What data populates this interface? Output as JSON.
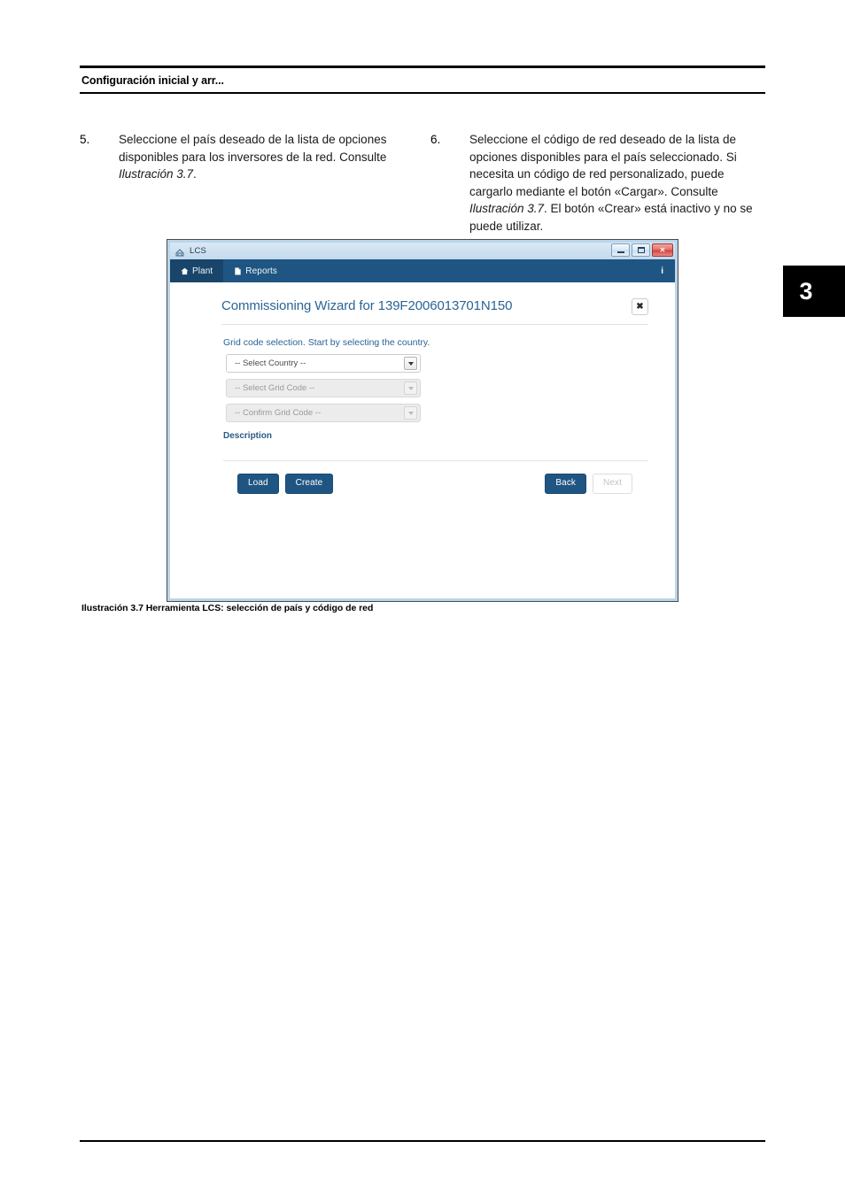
{
  "document": {
    "header_title": "Configuración inicial y arr...",
    "chapter_tab": "3",
    "figure_caption": "Ilustración 3.7 Herramienta LCS: selección de país y código de red"
  },
  "steps": [
    {
      "number": "5.",
      "text_before": "Seleccione el país deseado de la lista de opciones disponibles para los inversores de la red. Consulte ",
      "reference": "Ilustración 3.7",
      "text_after": "."
    },
    {
      "number": "6.",
      "text_before": "Seleccione el código de red deseado de la lista de opciones disponibles para el país seleccionado. Si necesita un código de red personalizado, puede cargarlo mediante el botón «Cargar». Consulte ",
      "reference": "Ilustración 3.7",
      "text_after": ". El botón «Crear» está inactivo y no se puede utilizar."
    }
  ],
  "app": {
    "window_title": "LCS",
    "window_controls": {
      "minimize": "minimize-icon",
      "maximize": "maximize-icon",
      "close": "close-icon"
    },
    "navbar": {
      "items": [
        {
          "label": "Plant",
          "icon": "home-icon",
          "active": true
        },
        {
          "label": "Reports",
          "icon": "document-icon",
          "active": false
        }
      ],
      "info_label": "i"
    },
    "wizard": {
      "title": "Commissioning Wizard for 139F2006013701N150",
      "close_label": "✖",
      "instruction": "Grid code selection. Start by selecting the country.",
      "selects": [
        {
          "value": "-- Select Country --",
          "disabled": false
        },
        {
          "value": "-- Select Grid Code --",
          "disabled": true
        },
        {
          "value": "-- Confirm Grid Code --",
          "disabled": true
        }
      ],
      "description_label": "Description",
      "buttons_left": [
        {
          "label": "Load",
          "disabled": false
        },
        {
          "label": "Create",
          "disabled": false
        }
      ],
      "buttons_right": [
        {
          "label": "Back",
          "disabled": false
        },
        {
          "label": "Next",
          "disabled": true
        }
      ]
    }
  },
  "colors": {
    "navbar_blue": "#1f5582",
    "navbar_active": "#19456a",
    "heading_blue": "#2a6496",
    "frame_blue": "#b9d5ea",
    "close_red": "#d1413c"
  }
}
